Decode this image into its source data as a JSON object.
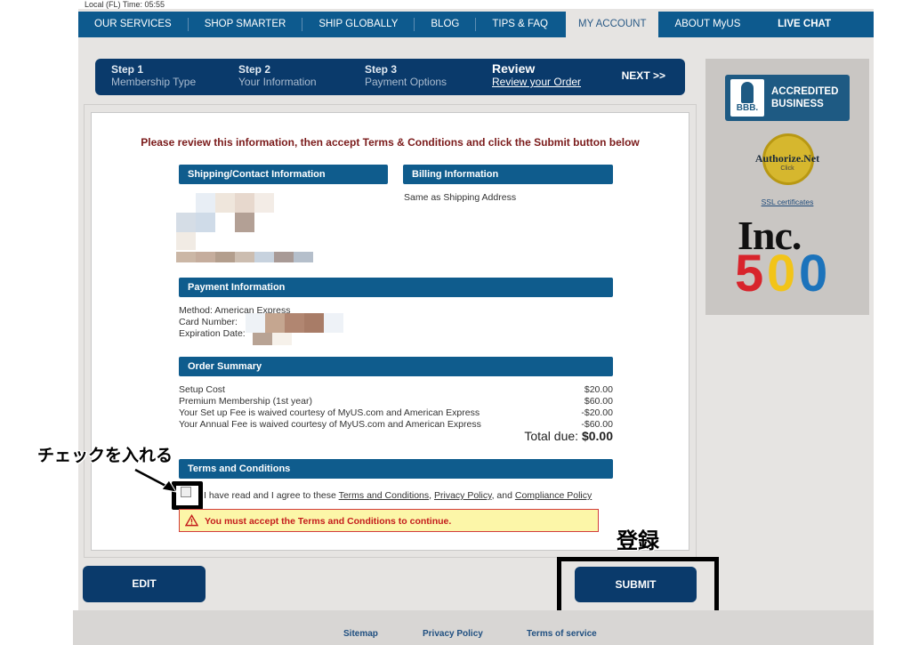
{
  "header": {
    "local_time": "Local (FL) Time: 05:55"
  },
  "nav": {
    "items": [
      "OUR SERVICES",
      "SHOP SMARTER",
      "SHIP GLOBALLY",
      "BLOG",
      "TIPS & FAQ",
      "MY ACCOUNT",
      "ABOUT MyUS"
    ],
    "active": "MY ACCOUNT",
    "live_chat": "LIVE CHAT"
  },
  "steps": {
    "items": [
      {
        "title": "Step 1",
        "subtitle": "Membership Type"
      },
      {
        "title": "Step 2",
        "subtitle": "Your Information"
      },
      {
        "title": "Step 3",
        "subtitle": "Payment Options"
      },
      {
        "title": "Review",
        "subtitle": "Review your Order"
      }
    ],
    "next": "NEXT >>"
  },
  "badges": {
    "bbb_logo": "BBB.",
    "bbb_line1": "ACCREDITED",
    "bbb_line2": "BUSINESS",
    "authnet_name": "Authorize.Net",
    "authnet_click": "Click",
    "ssl_link": "SSL certificates",
    "inc": "Inc.",
    "inc_500": [
      "5",
      "0",
      "0"
    ]
  },
  "review": {
    "instructions": "Please review this information, then accept Terms & Conditions and click the Submit button below",
    "shipping_head": "Shipping/Contact Information",
    "billing_head": "Billing Information",
    "billing_text": "Same as Shipping Address",
    "payment_head": "Payment Information",
    "payment_method": "Method: American Express",
    "payment_card": "Card Number:",
    "payment_exp": "Expiration Date:",
    "order_head": "Order Summary",
    "order_rows": [
      {
        "label": "Setup Cost",
        "value": "$20.00"
      },
      {
        "label": "Premium Membership (1st year)",
        "value": "$60.00"
      },
      {
        "label": "Your Set up Fee is waived courtesy of MyUS.com and American Express",
        "value": "-$20.00"
      },
      {
        "label": "Your Annual Fee is waived courtesy of MyUS.com and American Express",
        "value": "-$60.00"
      }
    ],
    "total_label": "Total due:",
    "total_value": "$0.00",
    "terms_head": "Terms and Conditions",
    "terms_prefix": "I have read and I agree to these",
    "terms_link": "Terms and Conditions",
    "privacy_link": "Privacy Policy",
    "and_text": ", and",
    "compliance_link": "Compliance Policy",
    "warning": "You must accept the Terms and Conditions to continue."
  },
  "annotations": {
    "checkbox_note": "チェックを入れる",
    "submit_note": "登録"
  },
  "buttons": {
    "edit": "EDIT",
    "submit": "SUBMIT"
  },
  "footer": {
    "links": [
      "Sitemap",
      "Privacy Policy",
      "Terms of service"
    ]
  },
  "colors": {
    "nav_blue": "#0d5a8e",
    "dark_blue": "#0a3a6b",
    "section_blue": "#0f5c8d",
    "warning_bg": "#fcf6a8",
    "warning_red": "#c41c1c"
  }
}
